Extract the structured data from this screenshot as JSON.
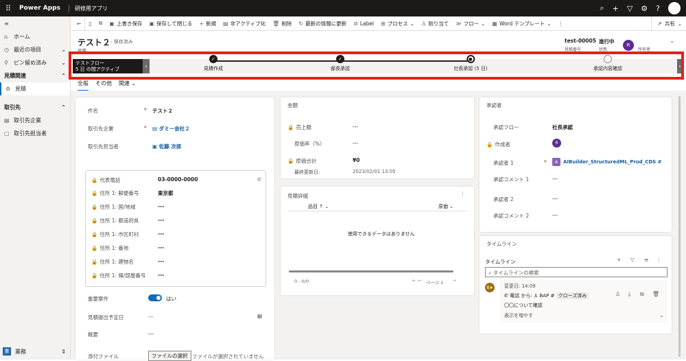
{
  "topbar": {
    "app_name": "Power Apps",
    "app_title": "研修用アプリ"
  },
  "nav": {
    "home": "ホーム",
    "recent": "最近の項目",
    "pinned": "ピン留め済み",
    "group1": "見積関連",
    "estimate": "見積",
    "group2": "取引先",
    "account": "取引先企業",
    "contact": "取引先担当者",
    "area": "業務",
    "area_badge": "業"
  },
  "cmd": {
    "back": "←",
    "save": "上書き保存",
    "save_close": "保存して閉じる",
    "new": "新規",
    "deactivate": "非アクティブ化",
    "delete": "削除",
    "refresh": "最新の情報に更新",
    "label": "Label",
    "process": "プロセス",
    "assign": "割り当て",
    "flow": "フロー",
    "word": "Word テンプレート",
    "more": "⋮",
    "share": "共有"
  },
  "header": {
    "title": "テスト２",
    "saved": "- 保存済み",
    "entity": "見積",
    "number": "test-00005",
    "number_label": "見積番号",
    "status": "進行中",
    "status_label": "状態",
    "owner_label": "所有者",
    "owner_initial": "R"
  },
  "bpf": {
    "active_name": "テストフロー",
    "active_time": "5 日 の間アクティブ",
    "stages": [
      {
        "label": "見積作成",
        "state": "done"
      },
      {
        "label": "部長承認",
        "state": "done"
      },
      {
        "label": "社長承認 (5 日)",
        "state": "current"
      },
      {
        "label": "承認内容確認",
        "state": "todo"
      }
    ]
  },
  "tabs": {
    "general": "全般",
    "other": "その他",
    "related": "関連"
  },
  "form": {
    "name_label": "件名",
    "name_value": "テスト２",
    "account_label": "取引先企業",
    "account_value": "ダミー会社２",
    "contact_label": "取引先担当者",
    "contact_value": "佐藤 次郎",
    "phone_label": "代表電話",
    "phone_value": "03-0000-0000",
    "zip_label": "住所 1: 郵便番号",
    "zip_value": "東京都",
    "country_label": "住所 1: 国/地域",
    "country_value": "---",
    "pref_label": "住所 1: 都道府県",
    "pref_value": "---",
    "city_label": "住所 1: 市区町村",
    "city_value": "---",
    "street_label": "住所 1: 番地",
    "street_value": "---",
    "bldg_label": "住所 1: 建物名",
    "bldg_value": "---",
    "floor_label": "住所 1: 棟/部屋番号",
    "floor_value": "---",
    "important_label": "重要案件",
    "important_value": "はい",
    "due_label": "見積提出予定日",
    "due_value": "---",
    "summary_label": "概要",
    "summary_value": "---",
    "attach_label": "添付ファイル",
    "attach_button": "ファイルの選択",
    "attach_none": "ファイルが選択されていません"
  },
  "amount": {
    "title": "金額",
    "sales_label": "売上額",
    "sales_value": "---",
    "cost_rate_label": "原価率（%）",
    "cost_rate_value": "---",
    "cost_total_label": "原価合計",
    "cost_total_value": "¥0",
    "updated_label": "最終更新日:",
    "updated_value": "2023/02/01 13:05"
  },
  "details": {
    "title": "見積詳細",
    "col1": "品目 ↑",
    "col2": "原価",
    "empty": "使用できるデータはありません",
    "count": "0 - 0/0",
    "page": "ページ 1"
  },
  "approver": {
    "title": "承認者",
    "flow_label": "承認フロー",
    "flow_value": "社長承認",
    "creator_label": "作成者",
    "creator_initial": "R",
    "a1_label": "承認者 1",
    "a1_value": "AIBuilder_StructuredML_Prod_CDS #",
    "a1_initial": "A",
    "c1_label": "承認コメント 1",
    "c1_value": "---",
    "a2_label": "承認者 2",
    "a2_value": "---",
    "c2_label": "承認コメント 2",
    "c2_value": "---"
  },
  "timeline": {
    "card_title": "タイムライン",
    "title": "タイムライン",
    "search": "タイムラインの検索",
    "item_initial": "B#",
    "item_time": "変更日: 14:09",
    "item_from": "電話 から:",
    "item_who": "BAP #",
    "item_status": "クローズ済み",
    "item_subject": "〇〇について確認",
    "show_more": "表示を増やす"
  }
}
